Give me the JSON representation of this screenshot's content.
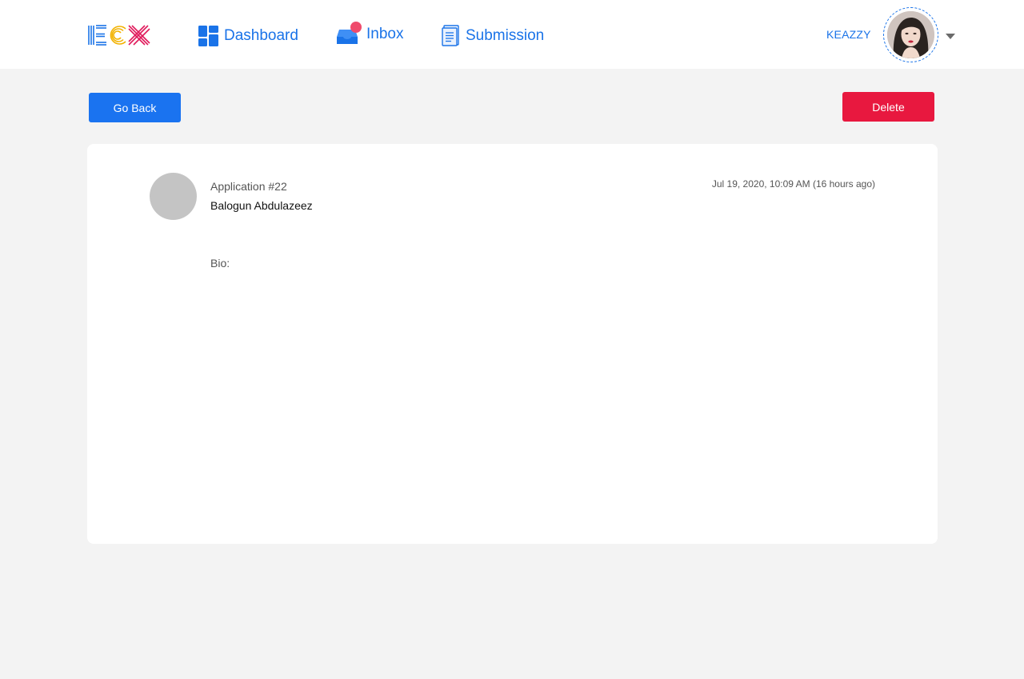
{
  "header": {
    "nav": {
      "dashboard": "Dashboard",
      "inbox": "Inbox",
      "submission": "Submission"
    },
    "username": "KEAZZY",
    "inbox_has_notification": true
  },
  "actions": {
    "go_back": "Go Back",
    "delete": "Delete"
  },
  "application": {
    "title": "Application #22",
    "applicant_name": "Balogun Abdulazeez",
    "timestamp": "Jul 19, 2020, 10:09 AM (16 hours ago)",
    "bio_label": "Bio:"
  },
  "colors": {
    "accent": "#1a73e8",
    "primary_button": "#1a73f0",
    "danger_button": "#e8183f",
    "notification": "#ef4b6c",
    "page_background": "#f3f3f3"
  },
  "icons": {
    "logo": "ecx-logo",
    "dashboard": "grid-icon",
    "inbox": "inbox-tray-icon",
    "submission": "document-icon",
    "dropdown": "caret-down-icon"
  }
}
